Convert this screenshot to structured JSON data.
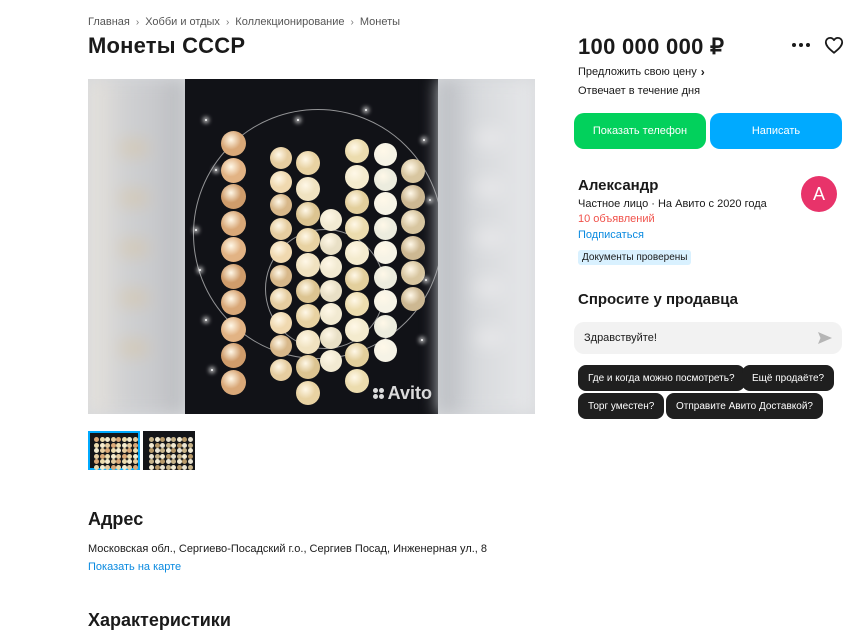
{
  "breadcrumb": [
    "Главная",
    "Хобби и отдых",
    "Коллекционирование",
    "Монеты"
  ],
  "title": "Монеты СССР",
  "gallery": {
    "watermark": "Avito",
    "thumbnail_count": 2,
    "active_thumbnail": 1
  },
  "address": {
    "heading": "Адрес",
    "text": "Московская обл., Сергиево-Посадский г.о., Сергиев Посад, Инженерная ул., 8",
    "map_link": "Показать на карте"
  },
  "characteristics": {
    "heading": "Характеристики"
  },
  "price": "100 000 000 ₽",
  "offer_price": "Предложить свою цену",
  "reply_time": "Отвечает в течение дня",
  "buttons": {
    "phone": "Показать телефон",
    "write": "Написать"
  },
  "seller": {
    "name": "Александр",
    "meta": "Частное лицо · На Авито с 2020 года",
    "ads": "10 объявлений",
    "subscribe": "Подписаться",
    "verified": "Документы проверены",
    "avatar_letter": "A"
  },
  "ask": {
    "heading": "Спросите у продавца",
    "message": "Здравствуйте!",
    "chips": [
      "Где и когда можно посмотреть?",
      "Ещё продаёте?",
      "Торг уместен?",
      "Отправите Авито Доставкой?"
    ]
  },
  "colors": {
    "green": "#02d15c",
    "blue": "#00aaff",
    "link": "#0a8ae0",
    "ads_red": "#f0524b",
    "avatar": "#e8336a"
  },
  "icons": [
    "chevron-right-icon",
    "more-icon",
    "heart-icon",
    "send-icon",
    "avito-logo-icon"
  ]
}
